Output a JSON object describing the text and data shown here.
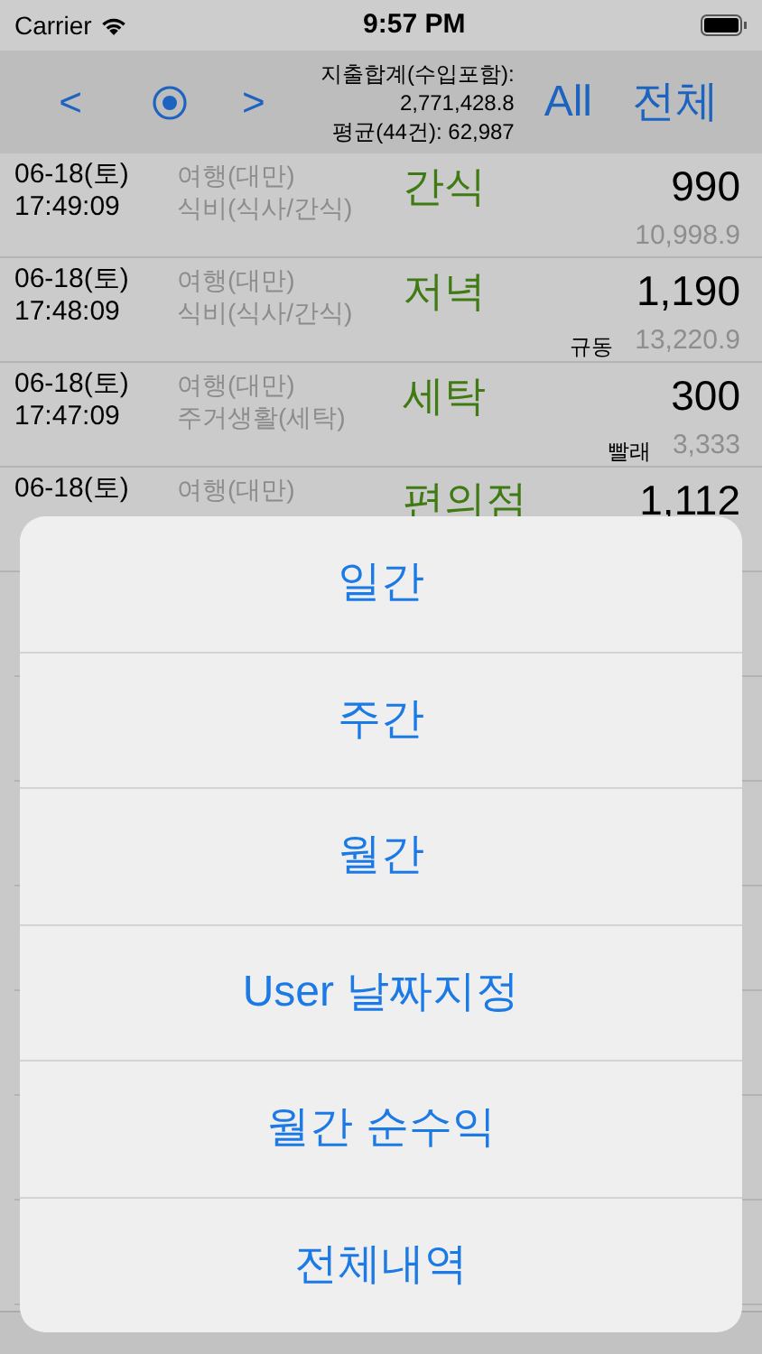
{
  "status_bar": {
    "carrier": "Carrier",
    "time": "9:57 PM"
  },
  "header": {
    "prev": "<",
    "next": ">",
    "total_label": "지출합계(수입포함):",
    "total_value": "2,771,428.8",
    "average": "평균(44건): 62,987",
    "all": "All",
    "all_korean": "전체"
  },
  "rows": [
    {
      "date": "06-18(토)",
      "time": "17:49:09",
      "category": "여행(대만)",
      "subcategory": "식비(식사/간식)",
      "item": "간식",
      "amount": "990",
      "memo": "",
      "converted": "10,998.9"
    },
    {
      "date": "06-18(토)",
      "time": "17:48:09",
      "category": "여행(대만)",
      "subcategory": "식비(식사/간식)",
      "item": "저녁",
      "amount": "1,190",
      "memo": "규동",
      "converted": "13,220.9"
    },
    {
      "date": "06-18(토)",
      "time": "17:47:09",
      "category": "여행(대만)",
      "subcategory": "주거생활(세탁)",
      "item": "세탁",
      "amount": "300",
      "memo": "빨래",
      "converted": "3,333"
    },
    {
      "date": "06-18(토)",
      "category": "여행(대만)",
      "item": "편의점",
      "amount": "1,112"
    }
  ],
  "action_sheet": [
    "일간",
    "주간",
    "월간",
    "User 날짜지정",
    "월간 순수익",
    "전체내역"
  ]
}
